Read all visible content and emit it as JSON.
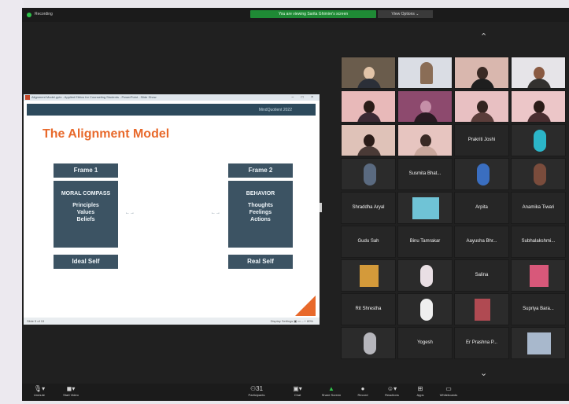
{
  "topbar": {
    "recording_label": "Recording",
    "share_banner": "You are viewing Sarita Ghimire's screen",
    "view_options": "View Options ⌄"
  },
  "shared_window": {
    "title": "Alignment Model.pptx - Applied Ethics for Counseling Students - PowerPoint - Slide Show",
    "controls": "– □ ×",
    "slide": {
      "band_text": "MindQuotient 2022",
      "title": "The Alignment Model",
      "left": {
        "frame": "Frame 1",
        "heading": "MORAL COMPASS",
        "items": [
          "Principles",
          "Values",
          "Beliefs"
        ],
        "footer": "Ideal Self"
      },
      "right": {
        "frame": "Frame 2",
        "heading": "BEHAVIOR",
        "items": [
          "Thoughts",
          "Feelings",
          "Actions"
        ],
        "footer": "Real Self"
      },
      "arrow_left": "←→",
      "arrow_right": "←→"
    },
    "status_left": "Slide 5 of 15",
    "status_right": "Display Settings  ▣  ▭  – +  80%"
  },
  "gallery": {
    "up_arrow": "⌃",
    "down_arrow": "⌄",
    "named_tiles": [
      "Prakriti Joshi",
      "Susmita Bhat...",
      "Shraddha Aryal",
      "Arpita",
      "Anamika Tiwari",
      "Gudu Sah",
      "Binu Tamrakar",
      "Aayusha Bhr...",
      "Subhalakshmi...",
      "Salina",
      "Rit Shrestha",
      "Supriya Bara...",
      "Yogesh",
      "Er Prashna P..."
    ]
  },
  "toolbar": {
    "unmute": "Unmute",
    "start_video": "Start Video",
    "participants": "Participants",
    "participants_count": "31",
    "chat": "Chat",
    "share_screen": "Share Screen",
    "record": "Record",
    "reactions": "Reactions",
    "apps": "Apps",
    "whiteboards": "Whiteboards"
  },
  "colors": {
    "zoom_bg": "#202020",
    "slide_accent": "#e8692b",
    "slide_box": "#3c5363",
    "share_green": "#1f8a35"
  }
}
